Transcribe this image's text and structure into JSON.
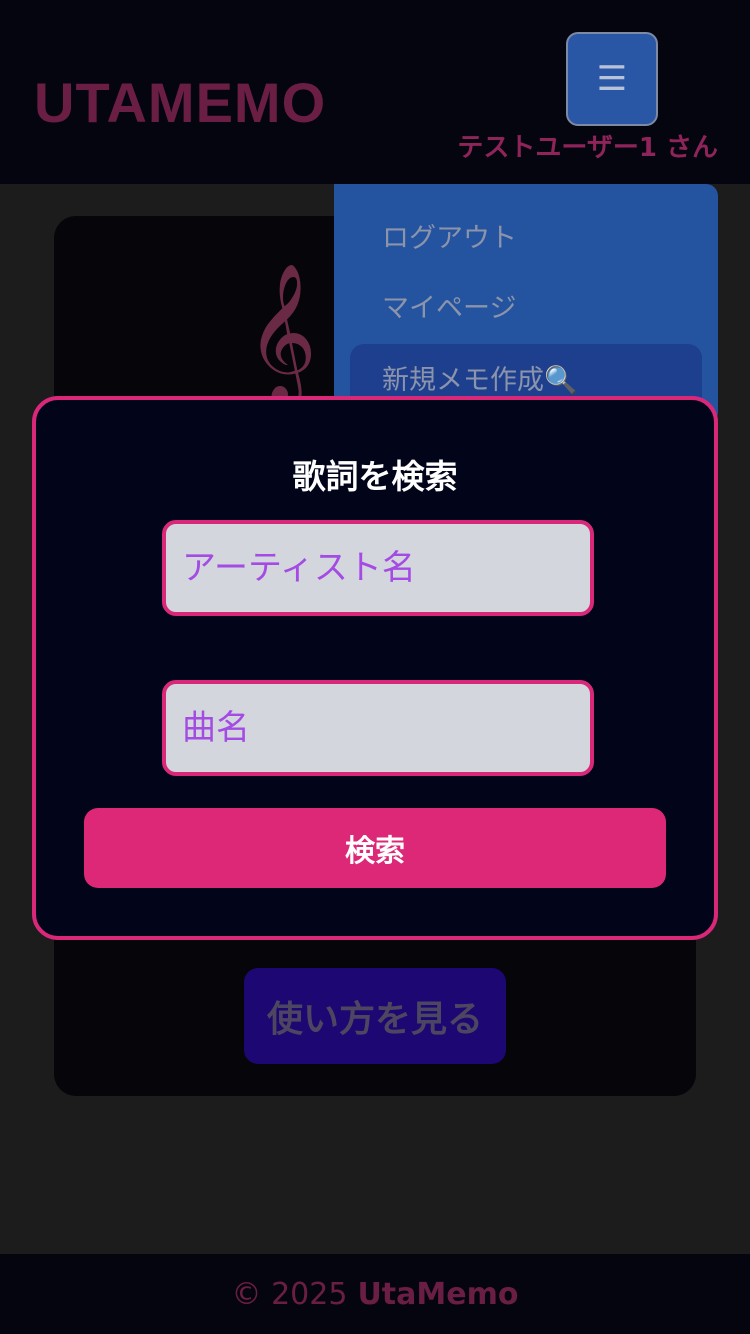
{
  "header": {
    "logo": "UTAMEMO",
    "menu_icon": "☰",
    "user_label": "テストユーザー1 さん"
  },
  "menu": {
    "items": [
      {
        "label": "ログアウト"
      },
      {
        "label": "マイページ"
      },
      {
        "label": "新規メモ作成🔍"
      }
    ]
  },
  "background_card": {
    "clef_icon": "𝄞",
    "howto_label": "使い方を見る"
  },
  "modal": {
    "title": "歌詞を検索",
    "artist_placeholder": "アーティスト名",
    "song_placeholder": "曲名",
    "search_label": "検索"
  },
  "footer": {
    "copyright": "© 2025",
    "brand": "UtaMemo"
  },
  "colors": {
    "accent": "#dd2777",
    "menu_blue": "#24539f",
    "placeholder": "#a44be4"
  }
}
